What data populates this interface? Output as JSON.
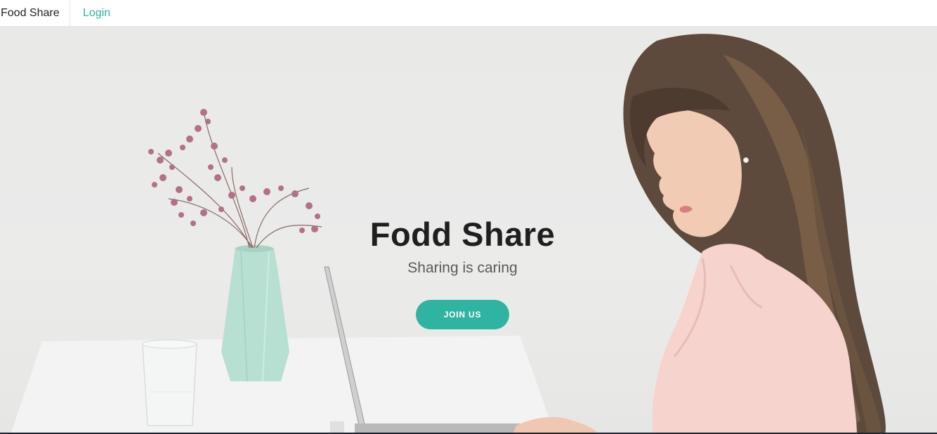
{
  "navbar": {
    "brand": "Food Share",
    "login_label": "Login"
  },
  "hero": {
    "title": "Fodd Share",
    "subtitle": "Sharing is caring",
    "cta_label": "JOIN US"
  },
  "colors": {
    "accent": "#2fb4a2",
    "link": "#2bb3a3",
    "title_text": "#1f1f1f",
    "subtitle_text": "#5a5a5a",
    "hero_background": "#e9e9e8"
  },
  "icons": {
    "hero_image": "woman-at-laptop-photo"
  }
}
